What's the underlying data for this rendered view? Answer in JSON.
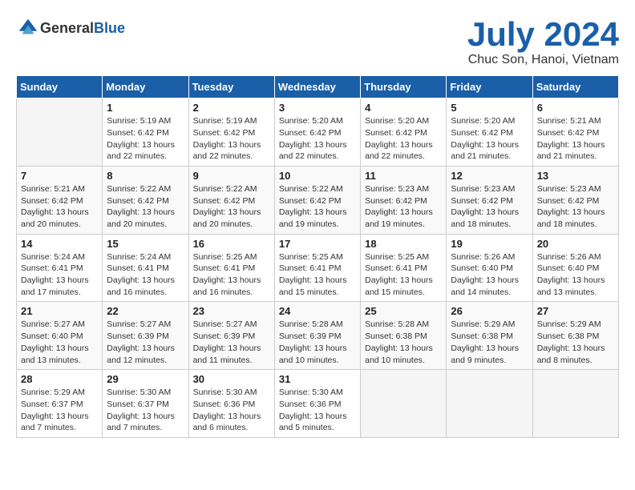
{
  "header": {
    "logo": {
      "general": "General",
      "blue": "Blue"
    },
    "title": "July 2024",
    "location": "Chuc Son, Hanoi, Vietnam"
  },
  "calendar": {
    "days_of_week": [
      "Sunday",
      "Monday",
      "Tuesday",
      "Wednesday",
      "Thursday",
      "Friday",
      "Saturday"
    ],
    "weeks": [
      [
        {
          "day": "",
          "info": ""
        },
        {
          "day": "1",
          "info": "Sunrise: 5:19 AM\nSunset: 6:42 PM\nDaylight: 13 hours\nand 22 minutes."
        },
        {
          "day": "2",
          "info": "Sunrise: 5:19 AM\nSunset: 6:42 PM\nDaylight: 13 hours\nand 22 minutes."
        },
        {
          "day": "3",
          "info": "Sunrise: 5:20 AM\nSunset: 6:42 PM\nDaylight: 13 hours\nand 22 minutes."
        },
        {
          "day": "4",
          "info": "Sunrise: 5:20 AM\nSunset: 6:42 PM\nDaylight: 13 hours\nand 22 minutes."
        },
        {
          "day": "5",
          "info": "Sunrise: 5:20 AM\nSunset: 6:42 PM\nDaylight: 13 hours\nand 21 minutes."
        },
        {
          "day": "6",
          "info": "Sunrise: 5:21 AM\nSunset: 6:42 PM\nDaylight: 13 hours\nand 21 minutes."
        }
      ],
      [
        {
          "day": "7",
          "info": "Sunrise: 5:21 AM\nSunset: 6:42 PM\nDaylight: 13 hours\nand 20 minutes."
        },
        {
          "day": "8",
          "info": "Sunrise: 5:22 AM\nSunset: 6:42 PM\nDaylight: 13 hours\nand 20 minutes."
        },
        {
          "day": "9",
          "info": "Sunrise: 5:22 AM\nSunset: 6:42 PM\nDaylight: 13 hours\nand 20 minutes."
        },
        {
          "day": "10",
          "info": "Sunrise: 5:22 AM\nSunset: 6:42 PM\nDaylight: 13 hours\nand 19 minutes."
        },
        {
          "day": "11",
          "info": "Sunrise: 5:23 AM\nSunset: 6:42 PM\nDaylight: 13 hours\nand 19 minutes."
        },
        {
          "day": "12",
          "info": "Sunrise: 5:23 AM\nSunset: 6:42 PM\nDaylight: 13 hours\nand 18 minutes."
        },
        {
          "day": "13",
          "info": "Sunrise: 5:23 AM\nSunset: 6:42 PM\nDaylight: 13 hours\nand 18 minutes."
        }
      ],
      [
        {
          "day": "14",
          "info": "Sunrise: 5:24 AM\nSunset: 6:41 PM\nDaylight: 13 hours\nand 17 minutes."
        },
        {
          "day": "15",
          "info": "Sunrise: 5:24 AM\nSunset: 6:41 PM\nDaylight: 13 hours\nand 16 minutes."
        },
        {
          "day": "16",
          "info": "Sunrise: 5:25 AM\nSunset: 6:41 PM\nDaylight: 13 hours\nand 16 minutes."
        },
        {
          "day": "17",
          "info": "Sunrise: 5:25 AM\nSunset: 6:41 PM\nDaylight: 13 hours\nand 15 minutes."
        },
        {
          "day": "18",
          "info": "Sunrise: 5:25 AM\nSunset: 6:41 PM\nDaylight: 13 hours\nand 15 minutes."
        },
        {
          "day": "19",
          "info": "Sunrise: 5:26 AM\nSunset: 6:40 PM\nDaylight: 13 hours\nand 14 minutes."
        },
        {
          "day": "20",
          "info": "Sunrise: 5:26 AM\nSunset: 6:40 PM\nDaylight: 13 hours\nand 13 minutes."
        }
      ],
      [
        {
          "day": "21",
          "info": "Sunrise: 5:27 AM\nSunset: 6:40 PM\nDaylight: 13 hours\nand 13 minutes."
        },
        {
          "day": "22",
          "info": "Sunrise: 5:27 AM\nSunset: 6:39 PM\nDaylight: 13 hours\nand 12 minutes."
        },
        {
          "day": "23",
          "info": "Sunrise: 5:27 AM\nSunset: 6:39 PM\nDaylight: 13 hours\nand 11 minutes."
        },
        {
          "day": "24",
          "info": "Sunrise: 5:28 AM\nSunset: 6:39 PM\nDaylight: 13 hours\nand 10 minutes."
        },
        {
          "day": "25",
          "info": "Sunrise: 5:28 AM\nSunset: 6:38 PM\nDaylight: 13 hours\nand 10 minutes."
        },
        {
          "day": "26",
          "info": "Sunrise: 5:29 AM\nSunset: 6:38 PM\nDaylight: 13 hours\nand 9 minutes."
        },
        {
          "day": "27",
          "info": "Sunrise: 5:29 AM\nSunset: 6:38 PM\nDaylight: 13 hours\nand 8 minutes."
        }
      ],
      [
        {
          "day": "28",
          "info": "Sunrise: 5:29 AM\nSunset: 6:37 PM\nDaylight: 13 hours\nand 7 minutes."
        },
        {
          "day": "29",
          "info": "Sunrise: 5:30 AM\nSunset: 6:37 PM\nDaylight: 13 hours\nand 7 minutes."
        },
        {
          "day": "30",
          "info": "Sunrise: 5:30 AM\nSunset: 6:36 PM\nDaylight: 13 hours\nand 6 minutes."
        },
        {
          "day": "31",
          "info": "Sunrise: 5:30 AM\nSunset: 6:36 PM\nDaylight: 13 hours\nand 5 minutes."
        },
        {
          "day": "",
          "info": ""
        },
        {
          "day": "",
          "info": ""
        },
        {
          "day": "",
          "info": ""
        }
      ]
    ]
  }
}
